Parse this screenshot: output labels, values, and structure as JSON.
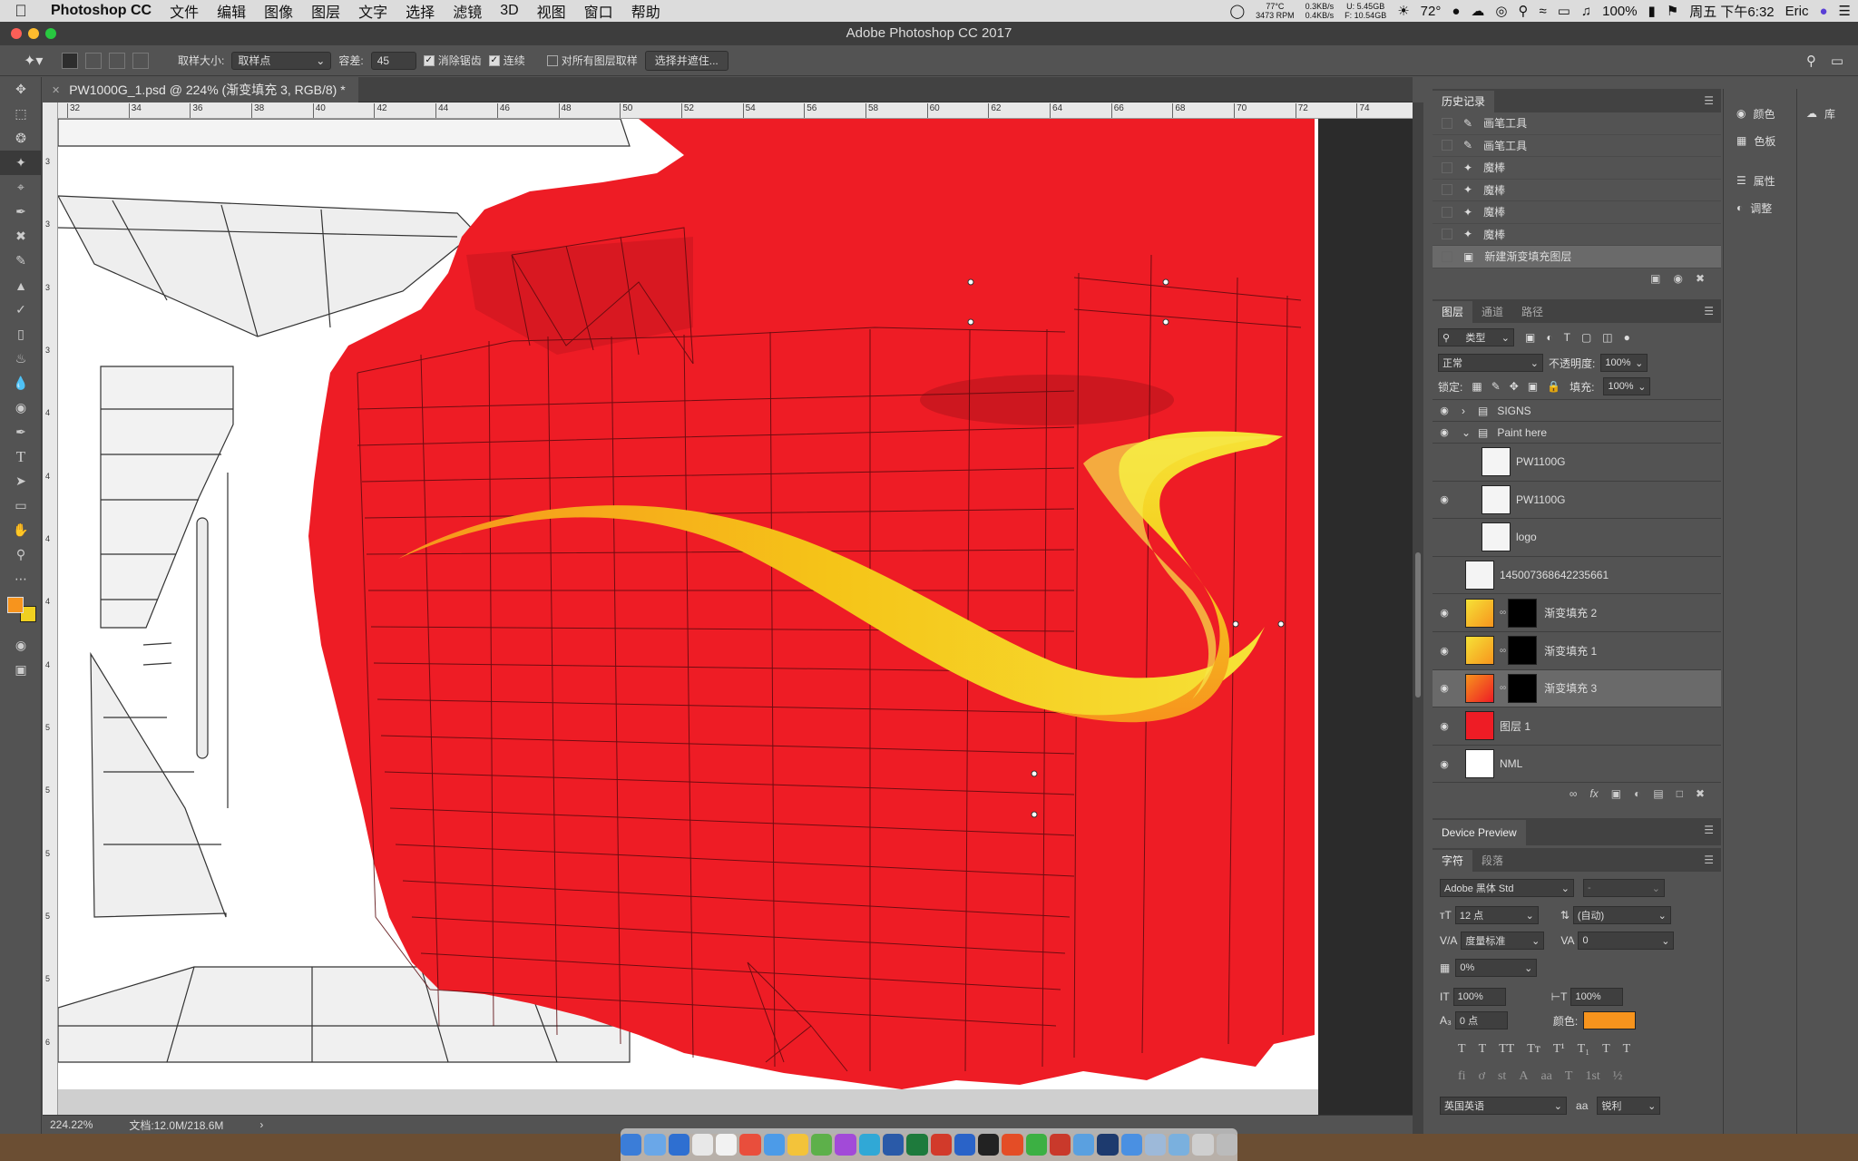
{
  "menubar": {
    "app_name": "Photoshop CC",
    "items": [
      "文件",
      "编辑",
      "图像",
      "图层",
      "文字",
      "选择",
      "滤镜",
      "3D",
      "视图",
      "窗口",
      "帮助"
    ],
    "temp": "77°C",
    "rpm": "3473 RPM",
    "net_up": "0.3KB/s",
    "net_down": "0.4KB/s",
    "disk_u": "U: 5.45GB",
    "disk_f": "F: 10.54GB",
    "weather": "72°",
    "battery": "100%",
    "datetime": "周五 下午6:32",
    "user": "Eric"
  },
  "window": {
    "title": "Adobe Photoshop CC 2017"
  },
  "options": {
    "sample_size_label": "取样大小:",
    "sample_size_value": "取样点",
    "tolerance_label": "容差:",
    "tolerance_value": "45",
    "antialias_label": "消除锯齿",
    "contiguous_label": "连续",
    "all_layers_label": "对所有图层取样",
    "select_mask_button": "选择并遮住..."
  },
  "document": {
    "tab_label": "PW1000G_1.psd @ 224% (渐变填充 3, RGB/8) *",
    "zoom": "224.22%",
    "doc_size": "文档:12.0M/218.6M"
  },
  "ruler": {
    "h_ticks": [
      "32",
      "34",
      "36",
      "38",
      "40",
      "42",
      "44",
      "46",
      "48",
      "50",
      "52",
      "54",
      "56",
      "58",
      "60",
      "62",
      "64",
      "66",
      "68",
      "70",
      "72",
      "74"
    ],
    "v_ticks": [
      "3",
      "3",
      "3",
      "3",
      "4",
      "4",
      "4",
      "4",
      "4",
      "5",
      "5",
      "5",
      "5",
      "5",
      "6"
    ]
  },
  "history": {
    "tab": "历史记录",
    "items": [
      "画笔工具",
      "画笔工具",
      "魔棒",
      "魔棒",
      "魔棒",
      "魔棒",
      "新建渐变填充图层"
    ],
    "selected_index": 6
  },
  "layers_panel": {
    "tabs": [
      "图层",
      "通道",
      "路径"
    ],
    "filter": "类型",
    "blend_mode": "正常",
    "opacity_label": "不透明度:",
    "opacity": "100%",
    "lock_label": "锁定:",
    "fill_label": "填充:",
    "fill": "100%",
    "layers": [
      {
        "name": "SIGNS",
        "visible": true,
        "kind": "group-closed"
      },
      {
        "name": "Paint here",
        "visible": true,
        "kind": "group-open"
      },
      {
        "name": "PW1100G",
        "visible": false,
        "kind": "layer-indent"
      },
      {
        "name": "PW1100G",
        "visible": true,
        "kind": "layer-indent"
      },
      {
        "name": "logo",
        "visible": false,
        "kind": "layer-indent"
      },
      {
        "name": "145007368642235661",
        "visible": false,
        "kind": "layer"
      },
      {
        "name": "渐变填充 2",
        "visible": true,
        "kind": "fill"
      },
      {
        "name": "渐变填充 1",
        "visible": true,
        "kind": "fill"
      },
      {
        "name": "渐变填充 3",
        "visible": true,
        "kind": "fill",
        "selected": true
      },
      {
        "name": "图层 1",
        "visible": true,
        "kind": "layer"
      },
      {
        "name": "NML",
        "visible": true,
        "kind": "layer"
      }
    ]
  },
  "device_preview": {
    "title": "Device Preview"
  },
  "character": {
    "tabs": [
      "字符",
      "段落"
    ],
    "font": "Adobe 黑体 Std",
    "style": "-",
    "size": "12 点",
    "leading": "(自动)",
    "kerning": "度量标准",
    "tracking": "0",
    "scale_pct": "0%",
    "v_scale": "100%",
    "h_scale": "100%",
    "baseline": "0 点",
    "color_label": "颜色:",
    "color": "#f7941d",
    "language": "英国英语",
    "aa_label": "a",
    "antialias": "锐利",
    "style_buttons": [
      "T",
      "T",
      "TT",
      "Tт",
      "T¹",
      "T₁",
      "T",
      "T"
    ],
    "ot_buttons": [
      "fi",
      "ơ",
      "st",
      "A",
      "aa",
      "T",
      "1st",
      "½"
    ]
  },
  "side_panels": {
    "items": [
      "颜色",
      "色板",
      "属性",
      "调整"
    ],
    "library": "库"
  },
  "colors": {
    "foreground": "#f7941d",
    "background": "#f0d020",
    "paint_red": "#ee1c25"
  }
}
